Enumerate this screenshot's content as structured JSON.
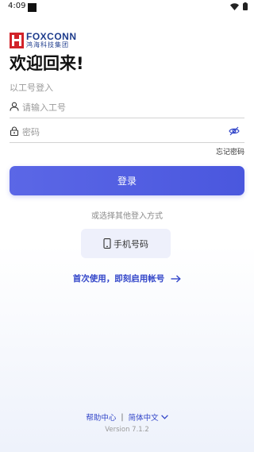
{
  "status_bar": {
    "time": "4:09"
  },
  "logo": {
    "en": "FOXCONN",
    "cn": "鸿海科技集团",
    "color": "#1e3c8c",
    "mark_color": "#d2232a"
  },
  "title": "欢迎回来!",
  "subtitle": "以工号登入",
  "form": {
    "user_placeholder": "请输入工号",
    "password_placeholder": "密码",
    "forgot_label": "忘记密码",
    "login_label": "登录"
  },
  "alt_login": {
    "text": "或选择其他登入方式",
    "phone_label": "手机号码"
  },
  "first_use_label": "首次使用，即刻启用帐号",
  "footer": {
    "help_label": "帮助中心",
    "separator": "|",
    "language_label": "简体中文",
    "version": "Version 7.1.2"
  },
  "colors": {
    "accent": "#4a57de",
    "link": "#3346c9"
  }
}
